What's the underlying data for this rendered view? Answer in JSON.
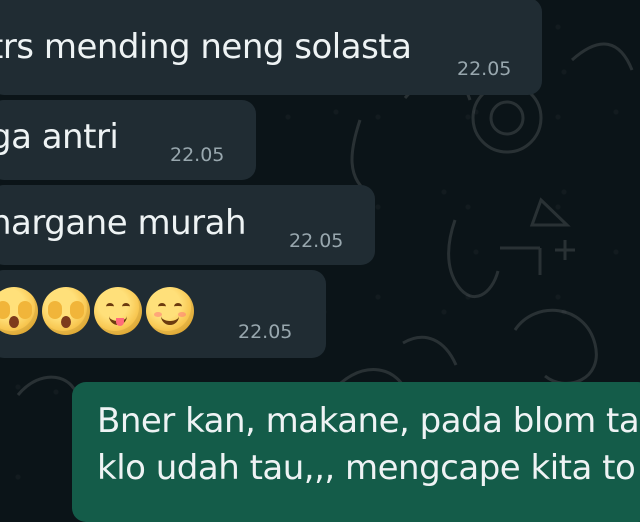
{
  "messages": [
    {
      "text": "trs mending neng solasta",
      "time": "22.05"
    },
    {
      "text": "ga antri",
      "time": "22.05"
    },
    {
      "text": "hargane murah",
      "time": "22.05"
    },
    {
      "emoji_icons": [
        "face-with-hand-over-mouth-icon",
        "face-with-hand-over-mouth-icon",
        "face-savoring-food-icon",
        "smiling-face-icon"
      ],
      "time": "22.05"
    }
  ],
  "outgoing_message": {
    "lines": [
      "Bner kan, makane, pada blom tau",
      "klo udah tau,,, mengcape kita to"
    ]
  },
  "colors": {
    "background": "#0b1418",
    "incoming_bubble": "#202c33",
    "outgoing_bubble": "#145c49",
    "text": "#eef3f4",
    "timestamp": "#98a7ae"
  }
}
